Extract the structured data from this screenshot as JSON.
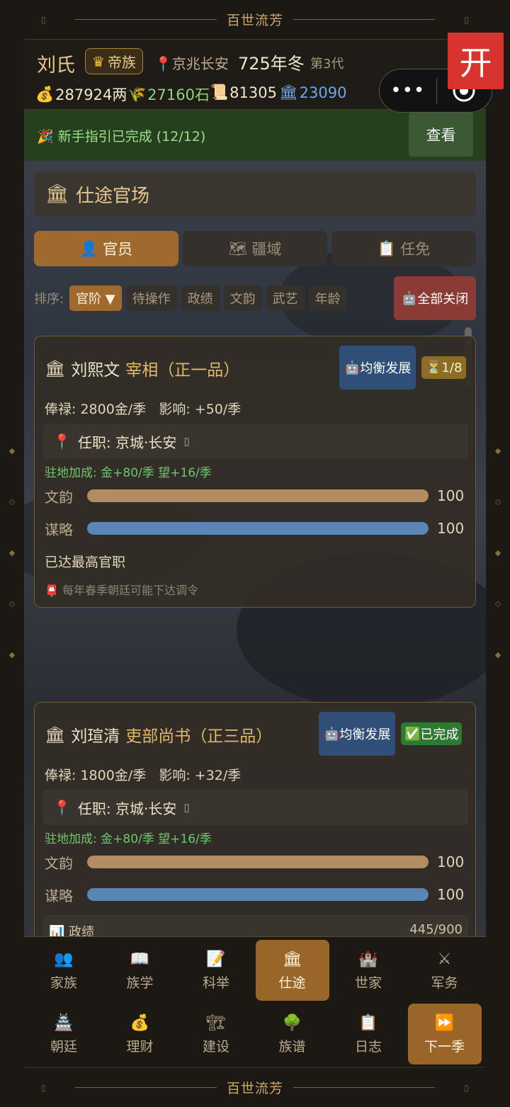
{
  "game_title": "百世流芳",
  "header": {
    "clan": "刘氏",
    "rank_badge": "帝族",
    "location": "京兆长安",
    "year": "725年冬",
    "generation": "第3代",
    "money": "287924两",
    "grain": "27160石",
    "scroll": "81305",
    "prestige": "23090"
  },
  "miniprogram": {
    "open_label": "开",
    "more_label": "•••"
  },
  "guide": {
    "text": "新手指引已完成 (12/12)",
    "button": "查看"
  },
  "section_title": "仕途官场",
  "tabs": [
    {
      "label": "官员",
      "icon": "person-icon",
      "active": true
    },
    {
      "label": "疆域",
      "icon": "map-icon",
      "active": false
    },
    {
      "label": "任免",
      "icon": "clipboard-icon",
      "active": false
    }
  ],
  "sort": {
    "label": "排序:",
    "options": [
      "官阶 ▼",
      "待操作",
      "政绩",
      "文韵",
      "武艺",
      "年龄"
    ],
    "active_index": 0,
    "close_all": "全部关闭"
  },
  "officials": [
    {
      "name": "刘熙文",
      "rank": "宰相（正一品）",
      "strategy": "均衡发展",
      "status": "1/8",
      "salary": "俸禄: 2800金/季",
      "influence": "影响: +50/季",
      "post": "任职: 京城·长安",
      "bonus": "驻地加成: 金+80/季  望+16/季",
      "stats": [
        {
          "label": "文韵",
          "value": "100",
          "fraction": 1.0,
          "color": "#b48c64"
        },
        {
          "label": "谋略",
          "value": "100",
          "fraction": 1.0,
          "color": "#5a86b6"
        }
      ],
      "note": "已达最高官职",
      "notice": "每年春季朝廷可能下达调令"
    },
    {
      "name": "刘瑄清",
      "rank": "吏部尚书（正三品）",
      "strategy": "均衡发展",
      "status": "已完成",
      "salary": "俸禄: 1800金/季",
      "influence": "影响: +32/季",
      "post": "任职: 京城·长安",
      "bonus": "驻地加成: 金+80/季  望+16/季",
      "stats": [
        {
          "label": "文韵",
          "value": "100",
          "fraction": 1.0,
          "color": "#b48c64"
        },
        {
          "label": "谋略",
          "value": "100",
          "fraction": 1.0,
          "color": "#5a86b6"
        }
      ],
      "performance_label": "政绩",
      "performance_value": "445/900"
    }
  ],
  "nav": [
    {
      "label": "家族",
      "icon": "family-icon"
    },
    {
      "label": "族学",
      "icon": "book-icon"
    },
    {
      "label": "科举",
      "icon": "memo-icon"
    },
    {
      "label": "仕途",
      "icon": "government-building-icon",
      "active": true
    },
    {
      "label": "世家",
      "icon": "castle-icon"
    },
    {
      "label": "军务",
      "icon": "crossed-swords-icon"
    },
    {
      "label": "朝廷",
      "icon": "palace-icon"
    },
    {
      "label": "理财",
      "icon": "money-bag-icon"
    },
    {
      "label": "建设",
      "icon": "crane-icon"
    },
    {
      "label": "族谱",
      "icon": "tree-icon"
    },
    {
      "label": "日志",
      "icon": "clipboard-icon"
    },
    {
      "label": "下一季",
      "icon": "fast-forward-icon",
      "active": true
    }
  ]
}
